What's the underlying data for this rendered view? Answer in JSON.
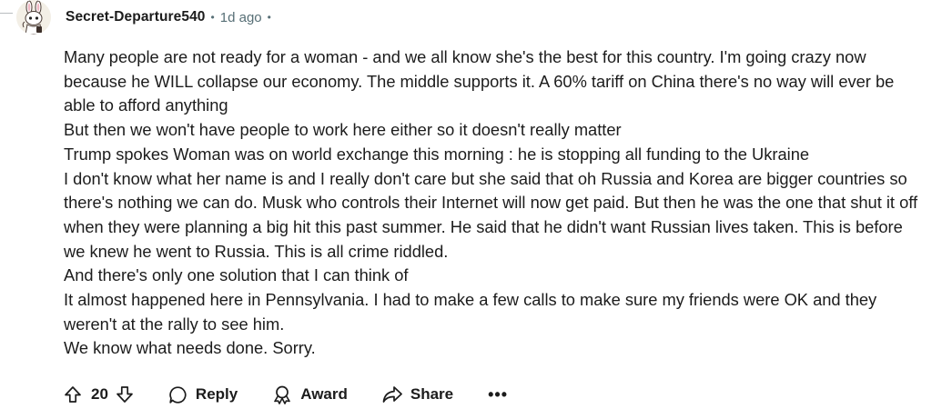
{
  "comment": {
    "author": "Secret-Departure540",
    "time": "1d ago",
    "separator": "•",
    "paragraphs": [
      "Many people are not ready for a woman - and we all know she's the best for this country. I'm going crazy now because he WILL collapse our economy. The middle supports it. A 60% tariff on China there's no way will ever be able to afford anything",
      "But then we won't have people to work here either so it doesn't really matter",
      "Trump spokes Woman was on world exchange this morning : he is stopping all funding to the Ukraine",
      "I don't know what her name is and I really don't care but she said that oh Russia and Korea are bigger countries so there's nothing we can do. Musk who controls their Internet will now get paid. But then he was the one that shut it off when they were planning a big hit this past summer. He said that he didn't want Russian lives taken. This is before we knew he went to Russia. This is all crime riddled.",
      "And there's only one solution that I can think of",
      "It almost happened here in Pennsylvania. I had to make a few calls to make sure my friends were OK and they weren't at the rally to see him.",
      "We know what needs done. Sorry."
    ]
  },
  "actions": {
    "vote_count": "20",
    "reply_label": "Reply",
    "award_label": "Award",
    "share_label": "Share",
    "more_label": "•••",
    "upvote_icon": "arrow-up-outline-icon",
    "downvote_icon": "arrow-down-outline-icon",
    "reply_icon": "speech-bubble-icon",
    "award_icon": "award-ribbon-icon",
    "share_icon": "share-arrow-icon"
  }
}
